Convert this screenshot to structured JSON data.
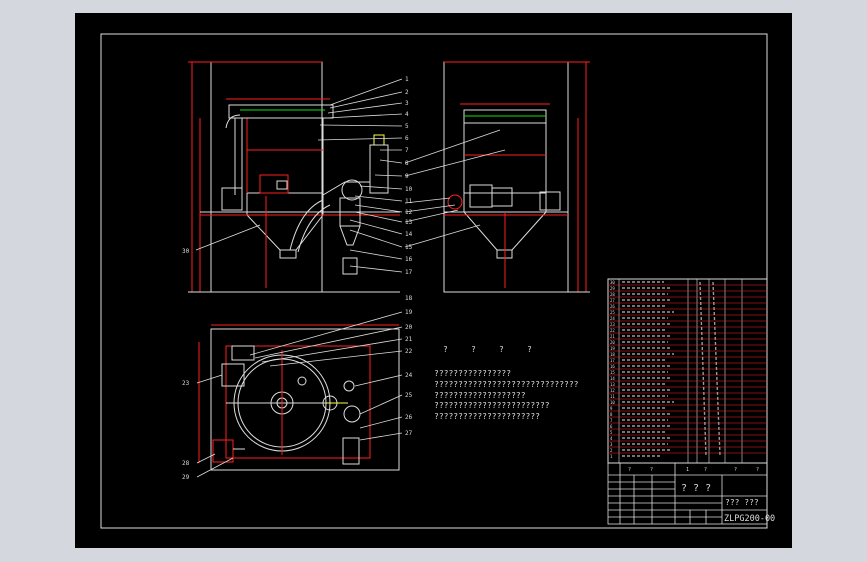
{
  "colors": {
    "background": "#d4d7de",
    "paper": "#000000",
    "line": "#ffffff",
    "dimension": "#ff2020",
    "green": "#10e010",
    "yellow": "#ffff40",
    "grey": "#9a9a9a"
  },
  "callouts_front": [
    "1",
    "2",
    "3",
    "4",
    "5",
    "6",
    "7",
    "8",
    "9",
    "10",
    "11",
    "12",
    "13",
    "14",
    "15",
    "16",
    "17"
  ],
  "callout_front_left": "30",
  "callouts_plan": [
    "18",
    "19",
    "20",
    "21",
    "22",
    "23",
    "24",
    "25",
    "26",
    "27",
    "28",
    "29"
  ],
  "tech_requirements": {
    "heading": [
      "?",
      "?",
      "?",
      "?"
    ],
    "lines": [
      "????????????????",
      "??????????????????????????????",
      "???????????????????",
      "????????????????????????",
      "??????????????????????"
    ]
  },
  "title_block": {
    "drawing_title": "? ? ?",
    "name": "??? ???",
    "drawing_no": "ZLPG200-00",
    "bom_row_numbers": [
      "30",
      "29",
      "28",
      "27",
      "26",
      "25",
      "24",
      "23",
      "22",
      "21",
      "20",
      "19",
      "18",
      "17",
      "16",
      "15",
      "14",
      "13",
      "12",
      "11",
      "10",
      "9",
      "8",
      "7",
      "6",
      "5",
      "4",
      "3",
      "2",
      "1"
    ]
  }
}
